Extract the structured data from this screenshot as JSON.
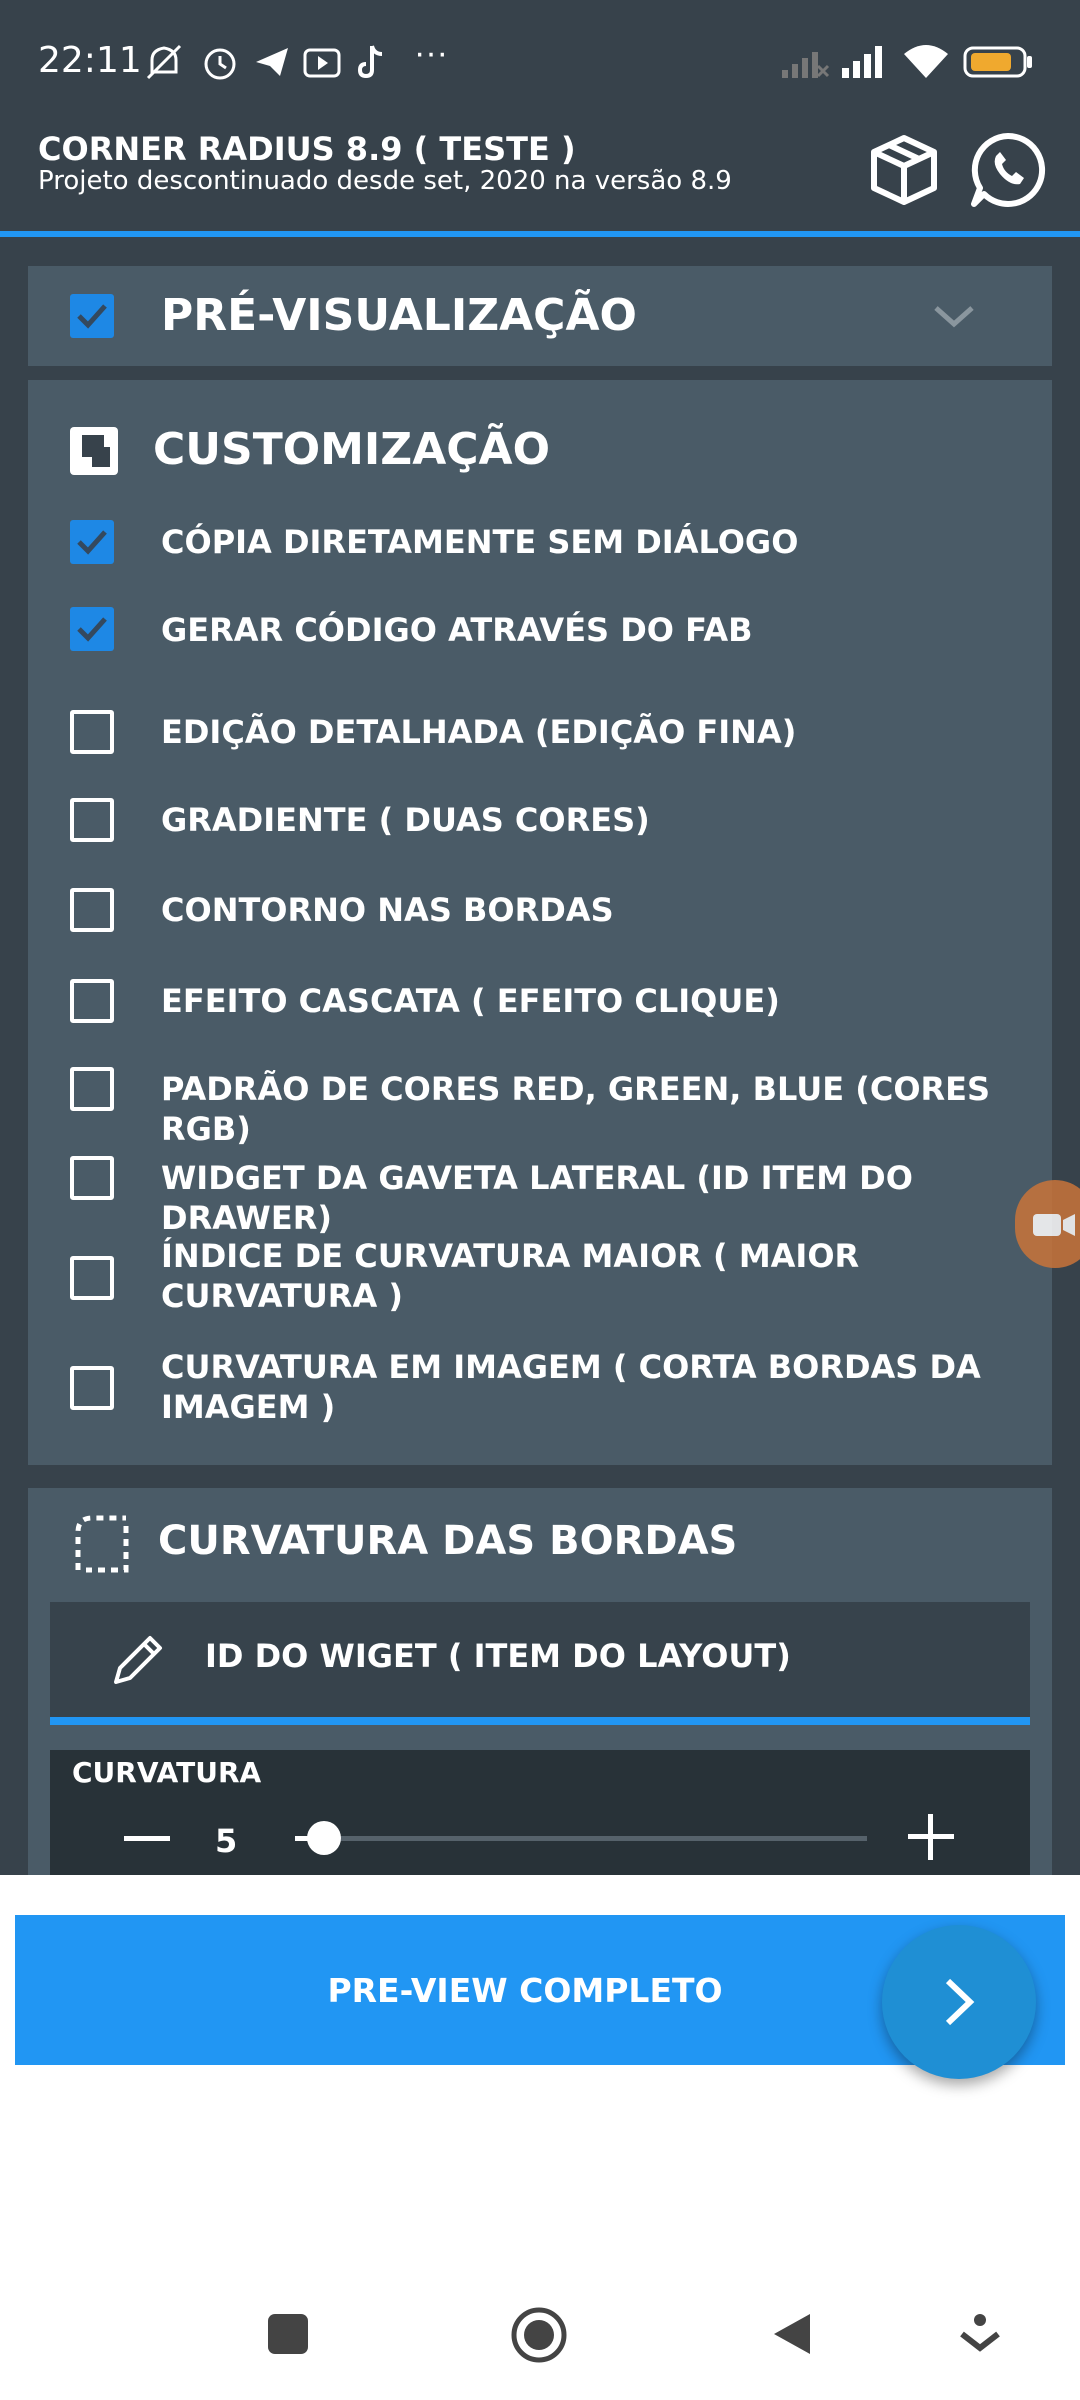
{
  "status_bar": {
    "time": "22:11",
    "icons": [
      "mute-icon",
      "alarm-icon",
      "telegram-icon",
      "youtube-icon",
      "tiktok-icon",
      "more-icon",
      "signal-weak-icon",
      "signal-icon",
      "wifi-icon",
      "battery-icon"
    ],
    "more": "···"
  },
  "header": {
    "title": "CORNER RADIUS 8.9 ( TESTE )",
    "subtitle": "Projeto descontinuado desde set, 2020 na versão 8.9",
    "actions": [
      "package-icon",
      "whatsapp-icon"
    ]
  },
  "preview_section": {
    "checked": true,
    "title": "PRÉ-VISUALIZAÇÃO"
  },
  "custom_section": {
    "title": "CUSTOMIZAÇÃO",
    "options": [
      {
        "label": "CÓPIA DIRETAMENTE SEM DIÁLOGO",
        "checked": true
      },
      {
        "label": "GERAR CÓDIGO ATRAVÉS DO FAB",
        "checked": true
      },
      {
        "label": "EDIÇÃO DETALHADA (EDIÇÃO FINA)",
        "checked": false
      },
      {
        "label": "GRADIENTE ( DUAS CORES)",
        "checked": false
      },
      {
        "label": "CONTORNO NAS BORDAS",
        "checked": false
      },
      {
        "label": "EFEITO CASCATA ( EFEITO CLIQUE)",
        "checked": false
      },
      {
        "label": "PADRÃO DE CORES RED, GREEN, BLUE (CORES RGB)",
        "checked": false
      },
      {
        "label": "WIDGET DA GAVETA LATERAL (ID ITEM DO DRAWER)",
        "checked": false
      },
      {
        "label": "ÍNDICE DE CURVATURA MAIOR ( MAIOR CURVATURA )",
        "checked": false
      },
      {
        "label": "CURVATURA EM IMAGEM ( CORTA BORDAS DA IMAGEM )",
        "checked": false
      }
    ]
  },
  "radius_section": {
    "title": "CURVATURA DAS BORDAS",
    "input_text": "ID DO WIGET ( ITEM DO LAYOUT)",
    "slider_label": "CURVATURA",
    "slider_value": "5",
    "slider_fraction": 0.05
  },
  "preview_button": {
    "label": "PRE-VIEW COMPLETO"
  },
  "colors": {
    "background": "#37424b",
    "card": "#4a5b67",
    "accent": "#2196f3",
    "fab": "#1f8fd4"
  }
}
